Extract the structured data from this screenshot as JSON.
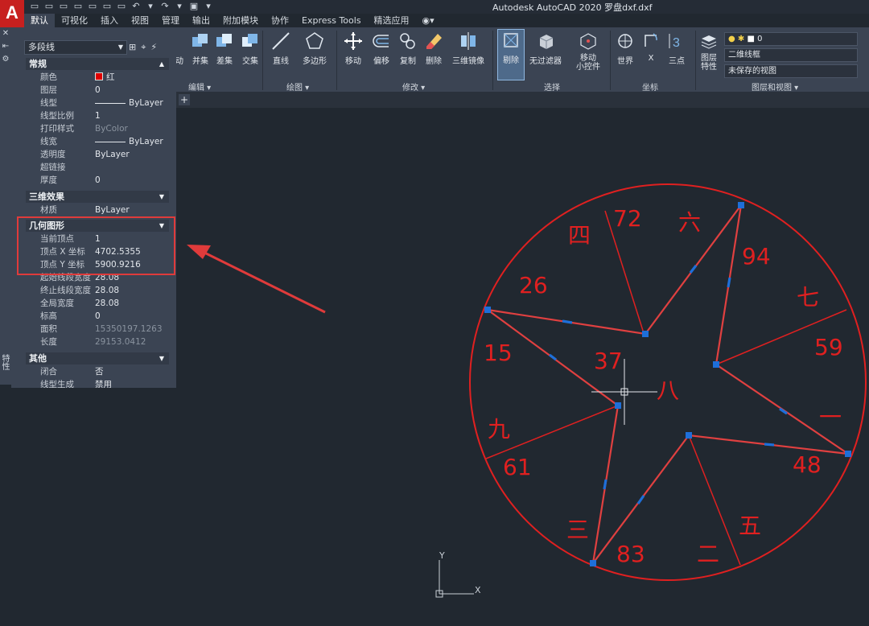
{
  "titlebar": {
    "title": "Autodesk AutoCAD 2020    罗盘dxf.dxf",
    "app_logo": "A"
  },
  "tabs": [
    "默认",
    "可视化",
    "插入",
    "视图",
    "管理",
    "输出",
    "附加模块",
    "协作",
    "Express Tools",
    "精选应用"
  ],
  "ribbon": {
    "buttons": {
      "move_partial": "动",
      "union": "并集",
      "subtract": "差集",
      "intersect": "交集",
      "line": "直线",
      "polygon": "多边形",
      "move": "移动",
      "offset": "偏移",
      "copy": "复制",
      "erase": "删除",
      "mirror3d": "三维镜像",
      "cull": "剔除",
      "no_filter": "无过滤器",
      "move_gizmo": "移动\n小控件",
      "world": "世界",
      "x": "X",
      "three_point": "三点",
      "layer_props": "图层\n特性"
    },
    "panels": {
      "edit": "编辑 ▾",
      "draw": "绘图 ▾",
      "modify": "修改 ▾",
      "selection": "选择",
      "coordinates": "坐标",
      "layers_view": "图层和视图 ▾"
    },
    "layer_combo": "0",
    "visual_style": "二维线框",
    "view_combo": "未保存的视图"
  },
  "palette": {
    "object_type": "多段线",
    "side_title": "特性",
    "sections": {
      "general": "常规",
      "effects3d": "三维效果",
      "geometry": "几何图形",
      "misc": "其他"
    },
    "general_rows": [
      {
        "label": "颜色",
        "value": "红"
      },
      {
        "label": "图层",
        "value": "0"
      },
      {
        "label": "线型",
        "value": "ByLayer"
      },
      {
        "label": "线型比例",
        "value": "1"
      },
      {
        "label": "打印样式",
        "value": "ByColor"
      },
      {
        "label": "线宽",
        "value": "ByLayer"
      },
      {
        "label": "透明度",
        "value": "ByLayer"
      },
      {
        "label": "超链接",
        "value": ""
      },
      {
        "label": "厚度",
        "value": "0"
      }
    ],
    "effects_rows": [
      {
        "label": "材质",
        "value": "ByLayer"
      }
    ],
    "geometry_rows": [
      {
        "label": "当前顶点",
        "value": "1"
      },
      {
        "label": "顶点 X 坐标",
        "value": "4702.5355"
      },
      {
        "label": "顶点 Y 坐标",
        "value": "5900.9216"
      },
      {
        "label": "起始线段宽度",
        "value": "28.08"
      },
      {
        "label": "终止线段宽度",
        "value": "28.08"
      },
      {
        "label": "全局宽度",
        "value": "28.08"
      },
      {
        "label": "标高",
        "value": "0"
      },
      {
        "label": "面积",
        "value": "15350197.1263"
      },
      {
        "label": "长度",
        "value": "29153.0412"
      }
    ],
    "misc_rows": [
      {
        "label": "闭合",
        "value": "否"
      },
      {
        "label": "线型生成",
        "value": "禁用"
      }
    ]
  },
  "drawing": {
    "sector_numbers": {
      "n72": "72",
      "n94": "94",
      "n26": "26",
      "n59": "59",
      "n37": "37",
      "n15": "15",
      "n61": "61",
      "n48": "48",
      "n83": "83"
    },
    "sector_glyphs": {
      "si": "四",
      "liu": "六",
      "qi": "七",
      "ba": "八",
      "jiu": "九",
      "yi": "一",
      "san": "三",
      "wu": "五",
      "er": "二"
    },
    "ucs_y": "Y",
    "ucs_x": "X",
    "line_color": "#e02020",
    "grip_color": "#1e6fd9"
  },
  "colors": {
    "canvas": "#212830",
    "ribbon": "#3b4453",
    "highlight": "#e03b3b"
  }
}
